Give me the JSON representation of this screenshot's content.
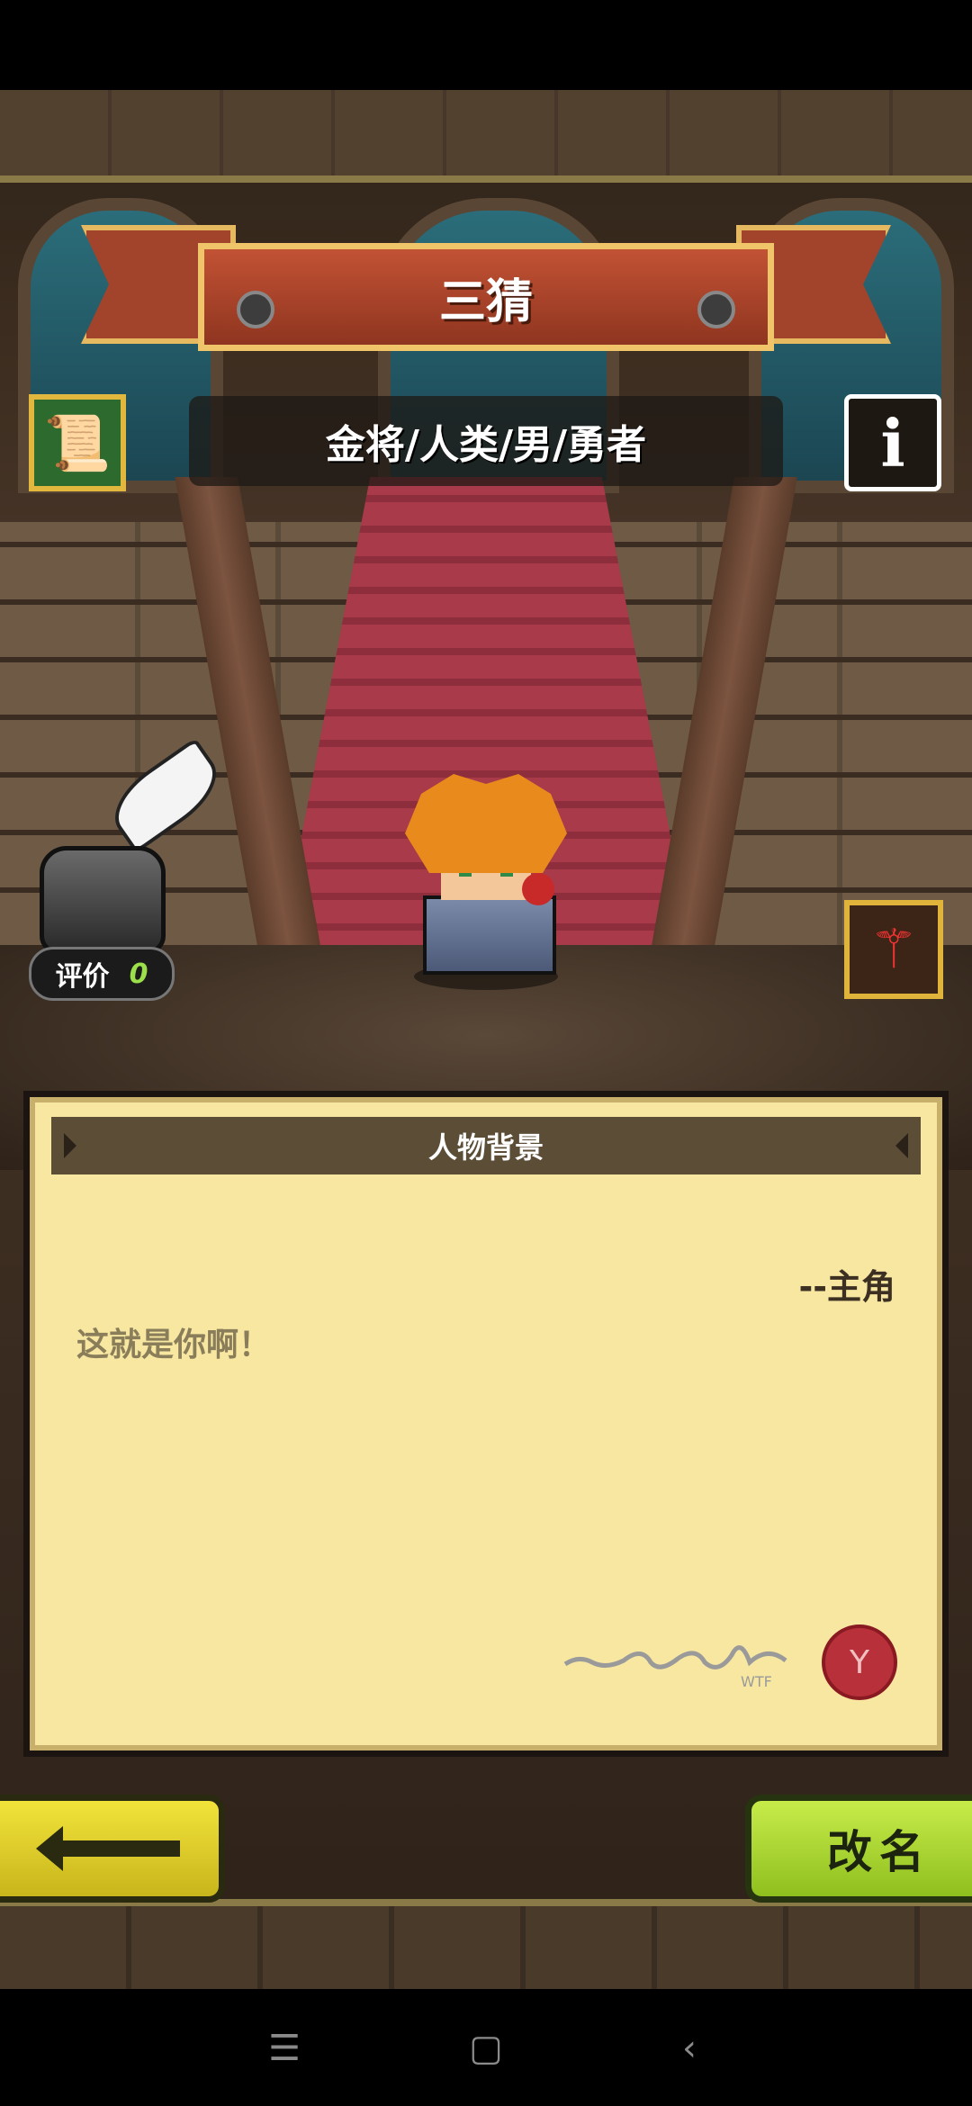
{
  "header": {
    "character_name": "三猜",
    "character_info": "金将/人类/男/勇者"
  },
  "buttons": {
    "scroll_icon": "scroll-icon",
    "info_label": "i",
    "staff_icon": "staff-icon",
    "rename_label": "改名",
    "back_icon": "left-arrow-icon"
  },
  "rating": {
    "label": "评价",
    "value": "0"
  },
  "panel": {
    "title": "人物背景",
    "author": "--主角",
    "bio": "这就是你啊！",
    "signature_text": "WTF"
  },
  "colors": {
    "banner": "#c25234",
    "parchment": "#f7e7a1",
    "back_button": "#f2e33a",
    "rename_button": "#c7ec4a"
  }
}
